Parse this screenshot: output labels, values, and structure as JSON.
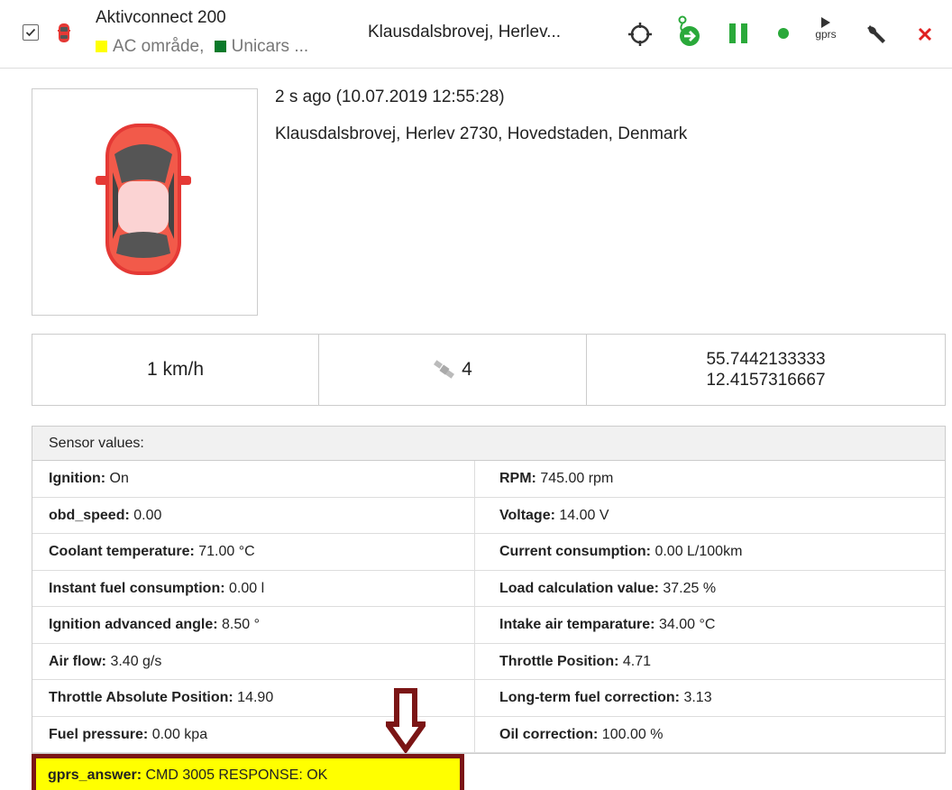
{
  "header": {
    "device_name": "Aktivconnect 200",
    "zones": [
      {
        "label": "AC område,",
        "color": "#ffff00"
      },
      {
        "label": "Unicars ...",
        "color": "#0a7a2a"
      }
    ],
    "address_short": "Klausdalsbrovej, Herlev...",
    "icons": [
      "locate-icon",
      "follow-route-icon",
      "pause-icon",
      "status-dot-icon",
      "gprs-command-icon",
      "wrench-icon",
      "close-icon"
    ],
    "gprs_label": "gprs",
    "colors": {
      "green": "#2aa93a",
      "red": "#e02020",
      "status_green": "#2aa93a"
    }
  },
  "info": {
    "time": "2 s ago (10.07.2019 12:55:28)",
    "address_full": "Klausdalsbrovej, Herlev 2730, Hovedstaden, Denmark"
  },
  "stats": {
    "speed": "1 km/h",
    "satellites": "4",
    "lat": "55.7442133333",
    "lng": "12.4157316667"
  },
  "sensors": {
    "title": "Sensor values:",
    "rows": [
      {
        "l_key": "Ignition:",
        "l_val": " On",
        "r_key": "RPM:",
        "r_val": " 745.00 rpm"
      },
      {
        "l_key": "obd_speed:",
        "l_val": " 0.00",
        "r_key": "Voltage:",
        "r_val": " 14.00 V"
      },
      {
        "l_key": "Coolant temperature:",
        "l_val": " 71.00 °C",
        "r_key": "Current consumption:",
        "r_val": " 0.00 L/100km"
      },
      {
        "l_key": "Instant fuel consumption:",
        "l_val": " 0.00 l",
        "r_key": "Load calculation value:",
        "r_val": " 37.25 %"
      },
      {
        "l_key": "Ignition advanced angle:",
        "l_val": " 8.50 °",
        "r_key": "Intake air temparature:",
        "r_val": " 34.00 °C"
      },
      {
        "l_key": "Air flow:",
        "l_val": " 3.40 g/s",
        "r_key": "Throttle Position:",
        "r_val": " 4.71"
      },
      {
        "l_key": "Throttle Absolute Position:",
        "l_val": " 14.90",
        "r_key": "Long-term fuel correction:",
        "r_val": " 3.13"
      },
      {
        "l_key": "Fuel pressure:",
        "l_val": " 0.00 kpa",
        "r_key": "Oil correction:",
        "r_val": " 100.00 %"
      }
    ],
    "highlight": {
      "key": "gprs_answer:",
      "val": " CMD 3005 RESPONSE: OK",
      "color": "#ffff00",
      "border": "#7b1515"
    }
  }
}
